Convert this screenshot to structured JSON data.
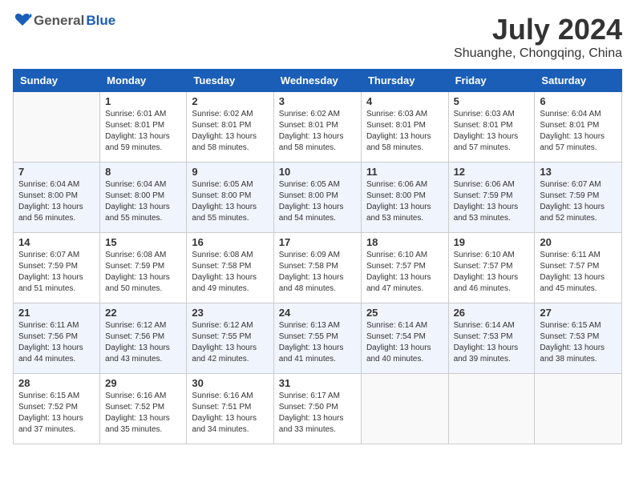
{
  "header": {
    "logo_general": "General",
    "logo_blue": "Blue",
    "month_year": "July 2024",
    "location": "Shuanghe, Chongqing, China"
  },
  "columns": [
    "Sunday",
    "Monday",
    "Tuesday",
    "Wednesday",
    "Thursday",
    "Friday",
    "Saturday"
  ],
  "weeks": [
    [
      {
        "day": "",
        "sunrise": "",
        "sunset": "",
        "daylight": ""
      },
      {
        "day": "1",
        "sunrise": "Sunrise: 6:01 AM",
        "sunset": "Sunset: 8:01 PM",
        "daylight": "Daylight: 13 hours and 59 minutes."
      },
      {
        "day": "2",
        "sunrise": "Sunrise: 6:02 AM",
        "sunset": "Sunset: 8:01 PM",
        "daylight": "Daylight: 13 hours and 58 minutes."
      },
      {
        "day": "3",
        "sunrise": "Sunrise: 6:02 AM",
        "sunset": "Sunset: 8:01 PM",
        "daylight": "Daylight: 13 hours and 58 minutes."
      },
      {
        "day": "4",
        "sunrise": "Sunrise: 6:03 AM",
        "sunset": "Sunset: 8:01 PM",
        "daylight": "Daylight: 13 hours and 58 minutes."
      },
      {
        "day": "5",
        "sunrise": "Sunrise: 6:03 AM",
        "sunset": "Sunset: 8:01 PM",
        "daylight": "Daylight: 13 hours and 57 minutes."
      },
      {
        "day": "6",
        "sunrise": "Sunrise: 6:04 AM",
        "sunset": "Sunset: 8:01 PM",
        "daylight": "Daylight: 13 hours and 57 minutes."
      }
    ],
    [
      {
        "day": "7",
        "sunrise": "Sunrise: 6:04 AM",
        "sunset": "Sunset: 8:00 PM",
        "daylight": "Daylight: 13 hours and 56 minutes."
      },
      {
        "day": "8",
        "sunrise": "Sunrise: 6:04 AM",
        "sunset": "Sunset: 8:00 PM",
        "daylight": "Daylight: 13 hours and 55 minutes."
      },
      {
        "day": "9",
        "sunrise": "Sunrise: 6:05 AM",
        "sunset": "Sunset: 8:00 PM",
        "daylight": "Daylight: 13 hours and 55 minutes."
      },
      {
        "day": "10",
        "sunrise": "Sunrise: 6:05 AM",
        "sunset": "Sunset: 8:00 PM",
        "daylight": "Daylight: 13 hours and 54 minutes."
      },
      {
        "day": "11",
        "sunrise": "Sunrise: 6:06 AM",
        "sunset": "Sunset: 8:00 PM",
        "daylight": "Daylight: 13 hours and 53 minutes."
      },
      {
        "day": "12",
        "sunrise": "Sunrise: 6:06 AM",
        "sunset": "Sunset: 7:59 PM",
        "daylight": "Daylight: 13 hours and 53 minutes."
      },
      {
        "day": "13",
        "sunrise": "Sunrise: 6:07 AM",
        "sunset": "Sunset: 7:59 PM",
        "daylight": "Daylight: 13 hours and 52 minutes."
      }
    ],
    [
      {
        "day": "14",
        "sunrise": "Sunrise: 6:07 AM",
        "sunset": "Sunset: 7:59 PM",
        "daylight": "Daylight: 13 hours and 51 minutes."
      },
      {
        "day": "15",
        "sunrise": "Sunrise: 6:08 AM",
        "sunset": "Sunset: 7:59 PM",
        "daylight": "Daylight: 13 hours and 50 minutes."
      },
      {
        "day": "16",
        "sunrise": "Sunrise: 6:08 AM",
        "sunset": "Sunset: 7:58 PM",
        "daylight": "Daylight: 13 hours and 49 minutes."
      },
      {
        "day": "17",
        "sunrise": "Sunrise: 6:09 AM",
        "sunset": "Sunset: 7:58 PM",
        "daylight": "Daylight: 13 hours and 48 minutes."
      },
      {
        "day": "18",
        "sunrise": "Sunrise: 6:10 AM",
        "sunset": "Sunset: 7:57 PM",
        "daylight": "Daylight: 13 hours and 47 minutes."
      },
      {
        "day": "19",
        "sunrise": "Sunrise: 6:10 AM",
        "sunset": "Sunset: 7:57 PM",
        "daylight": "Daylight: 13 hours and 46 minutes."
      },
      {
        "day": "20",
        "sunrise": "Sunrise: 6:11 AM",
        "sunset": "Sunset: 7:57 PM",
        "daylight": "Daylight: 13 hours and 45 minutes."
      }
    ],
    [
      {
        "day": "21",
        "sunrise": "Sunrise: 6:11 AM",
        "sunset": "Sunset: 7:56 PM",
        "daylight": "Daylight: 13 hours and 44 minutes."
      },
      {
        "day": "22",
        "sunrise": "Sunrise: 6:12 AM",
        "sunset": "Sunset: 7:56 PM",
        "daylight": "Daylight: 13 hours and 43 minutes."
      },
      {
        "day": "23",
        "sunrise": "Sunrise: 6:12 AM",
        "sunset": "Sunset: 7:55 PM",
        "daylight": "Daylight: 13 hours and 42 minutes."
      },
      {
        "day": "24",
        "sunrise": "Sunrise: 6:13 AM",
        "sunset": "Sunset: 7:55 PM",
        "daylight": "Daylight: 13 hours and 41 minutes."
      },
      {
        "day": "25",
        "sunrise": "Sunrise: 6:14 AM",
        "sunset": "Sunset: 7:54 PM",
        "daylight": "Daylight: 13 hours and 40 minutes."
      },
      {
        "day": "26",
        "sunrise": "Sunrise: 6:14 AM",
        "sunset": "Sunset: 7:53 PM",
        "daylight": "Daylight: 13 hours and 39 minutes."
      },
      {
        "day": "27",
        "sunrise": "Sunrise: 6:15 AM",
        "sunset": "Sunset: 7:53 PM",
        "daylight": "Daylight: 13 hours and 38 minutes."
      }
    ],
    [
      {
        "day": "28",
        "sunrise": "Sunrise: 6:15 AM",
        "sunset": "Sunset: 7:52 PM",
        "daylight": "Daylight: 13 hours and 37 minutes."
      },
      {
        "day": "29",
        "sunrise": "Sunrise: 6:16 AM",
        "sunset": "Sunset: 7:52 PM",
        "daylight": "Daylight: 13 hours and 35 minutes."
      },
      {
        "day": "30",
        "sunrise": "Sunrise: 6:16 AM",
        "sunset": "Sunset: 7:51 PM",
        "daylight": "Daylight: 13 hours and 34 minutes."
      },
      {
        "day": "31",
        "sunrise": "Sunrise: 6:17 AM",
        "sunset": "Sunset: 7:50 PM",
        "daylight": "Daylight: 13 hours and 33 minutes."
      },
      {
        "day": "",
        "sunrise": "",
        "sunset": "",
        "daylight": ""
      },
      {
        "day": "",
        "sunrise": "",
        "sunset": "",
        "daylight": ""
      },
      {
        "day": "",
        "sunrise": "",
        "sunset": "",
        "daylight": ""
      }
    ]
  ]
}
